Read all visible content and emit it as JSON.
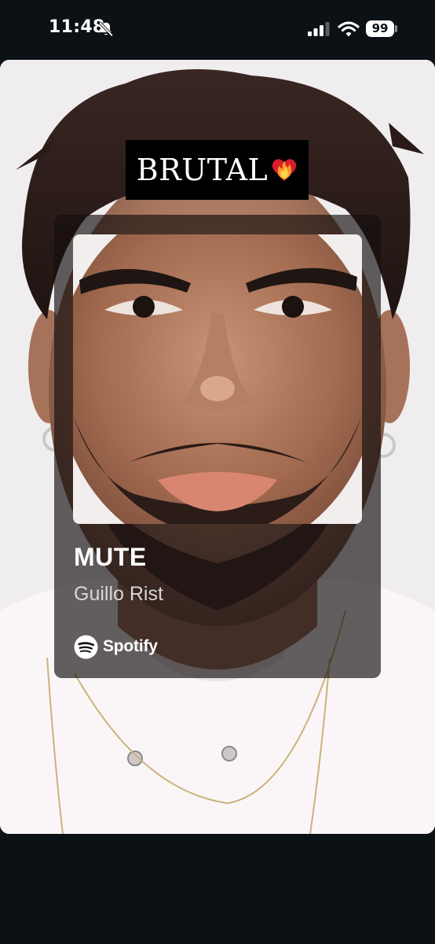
{
  "status_bar": {
    "time": "11:48",
    "icons": [
      "bell-slash-icon",
      "cellular-signal-icon",
      "wifi-icon"
    ],
    "battery_level": "99"
  },
  "story": {
    "caption": {
      "text": "BRUTAL",
      "emoji": "heart-on-fire-icon"
    },
    "music_card": {
      "title": "MUTE",
      "artist": "Guillo Rist",
      "service": "Spotify",
      "service_icon": "spotify-logo-icon"
    }
  },
  "colors": {
    "screen_bg": "#0c1116",
    "caption_bg": "#000000",
    "card_bg": "#140e0e",
    "text": "#ffffff",
    "artist_text": "#d8d6d6"
  }
}
